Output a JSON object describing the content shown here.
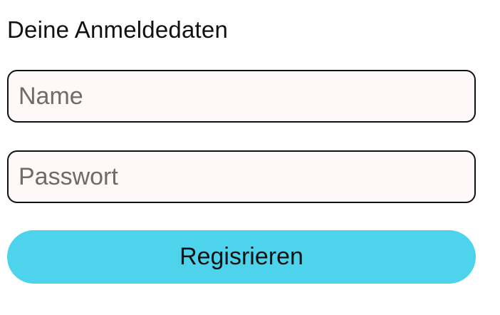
{
  "form": {
    "title": "Deine Anmeldedaten",
    "name_placeholder": "Name",
    "name_value": "",
    "password_placeholder": "Passwort",
    "password_value": "",
    "submit_label": "Regisrieren"
  },
  "colors": {
    "input_background": "#fff8f8",
    "input_border": "#111111",
    "placeholder_text": "#6f6b6a",
    "button_background": "#4dd3eb",
    "text": "#111111"
  }
}
